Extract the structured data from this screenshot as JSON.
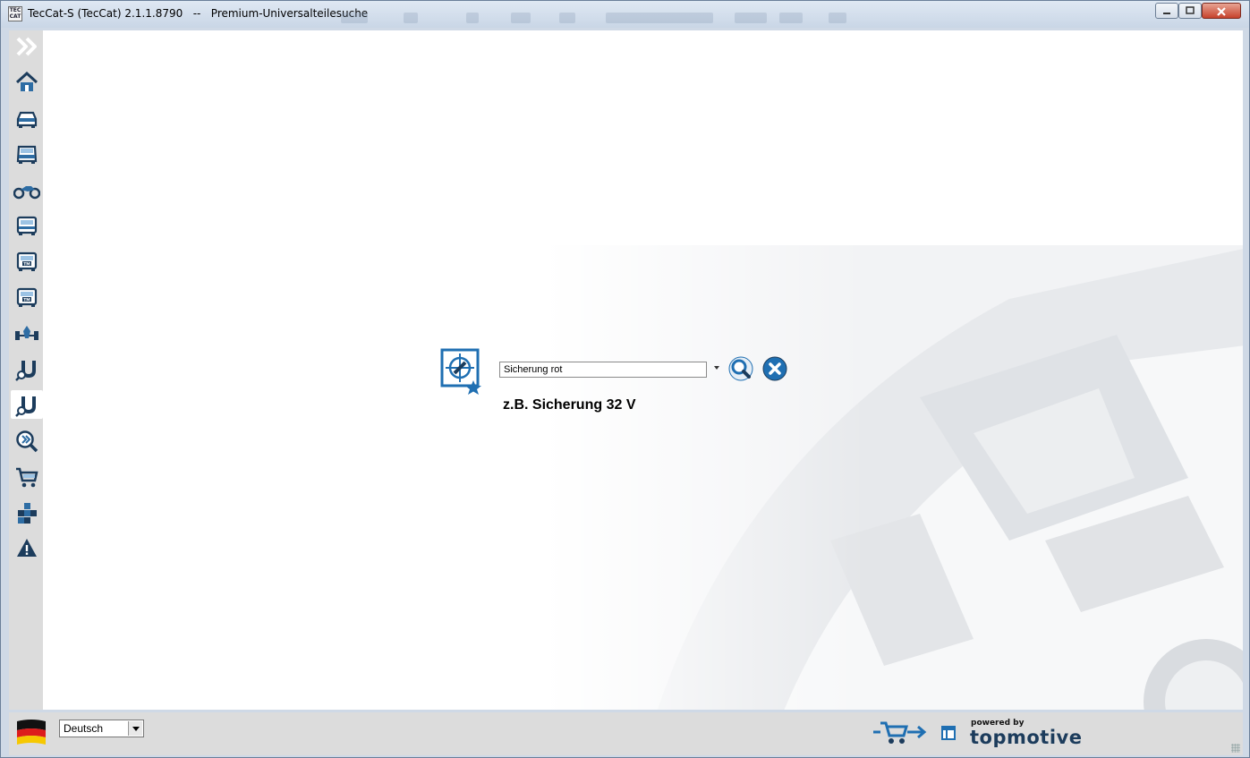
{
  "window": {
    "title": "TecCat-S (TecCat) 2.1.1.8790   --   Premium-Universalteilesuche",
    "app_icon_text": "TEC CAT",
    "controls": [
      "minimize",
      "maximize",
      "close"
    ]
  },
  "sidebar": {
    "items": [
      {
        "name": "expand",
        "icon": "double-chevron-right-icon",
        "active": false
      },
      {
        "name": "home",
        "icon": "home-icon",
        "active": false
      },
      {
        "name": "passenger-car",
        "icon": "car-icon",
        "active": false
      },
      {
        "name": "commercial-vehicle",
        "icon": "van-icon",
        "active": false
      },
      {
        "name": "motorcycle",
        "icon": "motorcycle-icon",
        "active": false
      },
      {
        "name": "truck",
        "icon": "truck-icon",
        "active": false
      },
      {
        "name": "truck-tm",
        "icon": "truck-tm-icon",
        "active": false
      },
      {
        "name": "truck-tm-2",
        "icon": "truck-tm-icon",
        "active": false
      },
      {
        "name": "axle",
        "icon": "axle-icon",
        "active": false
      },
      {
        "name": "universal-parts",
        "icon": "magnet-search-icon",
        "active": false
      },
      {
        "name": "premium-universal-parts",
        "icon": "magnet-search-icon",
        "active": true
      },
      {
        "name": "quick-search",
        "icon": "search-forward-icon",
        "active": false
      },
      {
        "name": "cart",
        "icon": "cart-icon",
        "active": false
      },
      {
        "name": "modules",
        "icon": "blocks-icon",
        "active": false
      },
      {
        "name": "warning",
        "icon": "warning-icon",
        "active": false
      }
    ]
  },
  "search": {
    "value": "Sicherung rot",
    "hint": "z.B. Sicherung 32 V",
    "search_icon": "search-icon",
    "clear_icon": "close-circle-icon"
  },
  "statusbar": {
    "language": "Deutsch",
    "flag": "germany-flag-icon",
    "powered_by": "powered by",
    "brand": "topmotive"
  },
  "colors": {
    "accent": "#1f6fb2",
    "icon_dark": "#1c3c5c",
    "sidebar_bg": "#dcdcdc"
  }
}
